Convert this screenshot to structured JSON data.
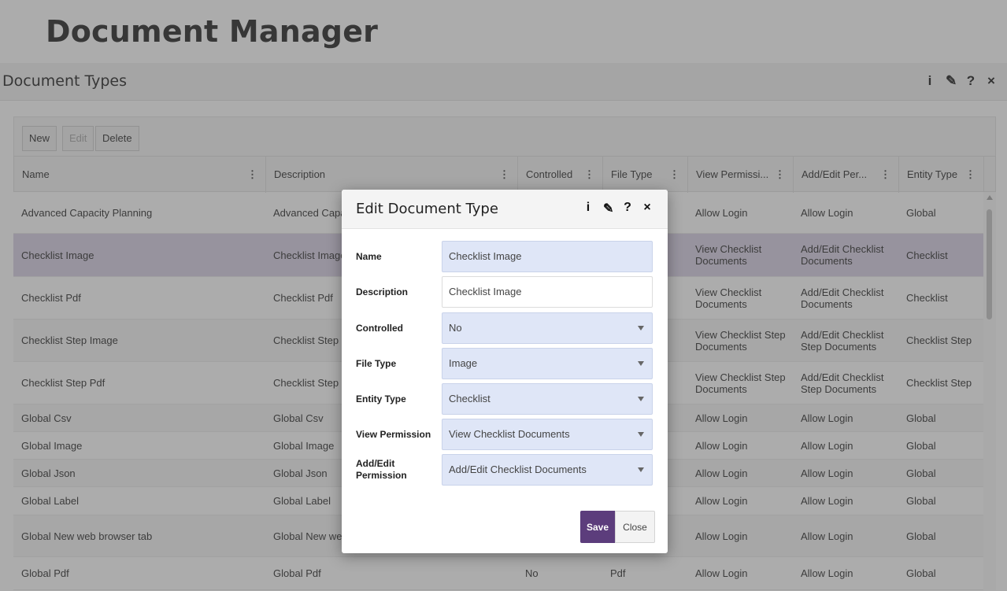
{
  "app_title": "Document Manager",
  "panel": {
    "title": "Document Types",
    "icons": [
      "info-icon",
      "pencil-icon",
      "help-icon",
      "close-icon"
    ],
    "icon_glyphs": {
      "info": "i",
      "edit": "✎",
      "help": "?",
      "close": "×"
    }
  },
  "toolbar": {
    "new_label": "New",
    "edit_label": "Edit",
    "delete_label": "Delete"
  },
  "grid": {
    "columns": [
      "Name",
      "Description",
      "Controlled",
      "File Type",
      "View Permissi...",
      "Add/Edit Per...",
      "Entity Type"
    ],
    "rows": [
      {
        "name": "Advanced Capacity Planning",
        "description": "Advanced Capa",
        "view": "Allow Login",
        "edit": "Allow Login",
        "entity": "Global"
      },
      {
        "name": "Checklist Image",
        "description": "Checklist Image",
        "view": "View Checklist Documents",
        "edit": "Add/Edit Checklist Documents",
        "entity": "Checklist"
      },
      {
        "name": "Checklist Pdf",
        "description": "Checklist Pdf",
        "view": "View Checklist Documents",
        "edit": "Add/Edit Checklist Documents",
        "entity": "Checklist"
      },
      {
        "name": "Checklist Step Image",
        "description": "Checklist Step",
        "view": "View Checklist Step Documents",
        "edit": "Add/Edit Checklist Step Documents",
        "entity": "Checklist Step"
      },
      {
        "name": "Checklist Step Pdf",
        "description": "Checklist Step",
        "view": "View Checklist Step Documents",
        "edit": "Add/Edit Checklist Step Documents",
        "entity": "Checklist Step"
      },
      {
        "name": "Global Csv",
        "description": "Global Csv",
        "view": "Allow Login",
        "edit": "Allow Login",
        "entity": "Global"
      },
      {
        "name": "Global Image",
        "description": "Global Image",
        "view": "Allow Login",
        "edit": "Allow Login",
        "entity": "Global"
      },
      {
        "name": "Global Json",
        "description": "Global Json",
        "view": "Allow Login",
        "edit": "Allow Login",
        "entity": "Global"
      },
      {
        "name": "Global Label",
        "description": "Global Label",
        "view": "Allow Login",
        "edit": "Allow Login",
        "entity": "Global"
      },
      {
        "name": "Global New web browser tab",
        "description": "Global New we",
        "view": "Allow Login",
        "edit": "Allow Login",
        "entity": "Global"
      },
      {
        "name": "Global Pdf",
        "description": "Global Pdf",
        "controlled": "No",
        "filetype": "Pdf",
        "view": "Allow Login",
        "edit": "Allow Login",
        "entity": "Global"
      }
    ]
  },
  "modal": {
    "title": "Edit Document Type",
    "fields": {
      "name": {
        "label": "Name",
        "value": "Checklist Image"
      },
      "description": {
        "label": "Description",
        "value": "Checklist Image"
      },
      "controlled": {
        "label": "Controlled",
        "value": "No"
      },
      "file_type": {
        "label": "File Type",
        "value": "Image"
      },
      "entity_type": {
        "label": "Entity Type",
        "value": "Checklist"
      },
      "view_permission": {
        "label": "View Permission",
        "value": "View Checklist Documents"
      },
      "edit_permission": {
        "label": "Add/Edit Permission",
        "value": "Add/Edit Checklist Documents"
      }
    },
    "save_label": "Save",
    "close_label": "Close"
  },
  "colors": {
    "accent": "#5c3d7c",
    "selected_row": "#d9d2e6",
    "field_bg": "#dfe6f7"
  }
}
